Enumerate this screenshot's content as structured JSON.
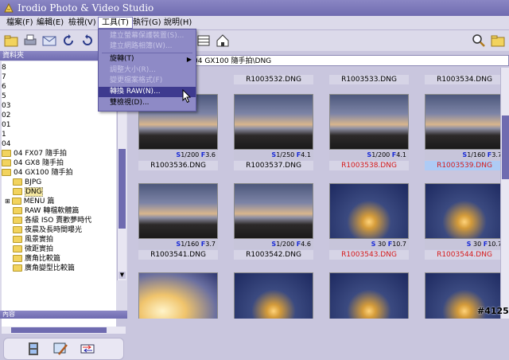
{
  "window": {
    "title": "Irodio Photo & Video Studio"
  },
  "menu": [
    {
      "label": "檔案(F)"
    },
    {
      "label": "編輯(E)"
    },
    {
      "label": "檢視(V)"
    },
    {
      "label": "工具(T)"
    },
    {
      "label": "執行(G)"
    },
    {
      "label": "說明(H)"
    }
  ],
  "tools_menu": [
    {
      "label": "建立螢幕保護裝置(S)...",
      "disabled": true
    },
    {
      "label": "建立網路相簿(W)...",
      "disabled": true
    },
    {
      "label": "旋轉(T)",
      "submenu": true
    },
    {
      "label": "調整大小(R)...",
      "disabled": true
    },
    {
      "label": "變更檔案格式(F)",
      "disabled": true
    },
    {
      "label": "轉換 RAW(N)...",
      "highlighted": true
    },
    {
      "label": "雙檢視(D)..."
    }
  ],
  "sidebar": {
    "header": "資料夾",
    "tree": [
      {
        "label": "8"
      },
      {
        "label": "7"
      },
      {
        "label": "6"
      },
      {
        "label": "5"
      },
      {
        "label": "03"
      },
      {
        "label": "02"
      },
      {
        "label": "01"
      },
      {
        "label": "1"
      },
      {
        "label": "04"
      },
      {
        "label": "04 FX07 隨手拍"
      },
      {
        "label": "04 GX8 隨手拍"
      },
      {
        "label": "04 GX100 隨手拍"
      },
      {
        "label": "BJPG"
      },
      {
        "label": "DNG"
      },
      {
        "label": "MENU 篇"
      },
      {
        "label": "RAW 轉檔軟體篇"
      },
      {
        "label": "各級 ISO 賣歡夢時代"
      },
      {
        "label": "夜晨及長時間曝光"
      },
      {
        "label": "風景實拍"
      },
      {
        "label": "微距實拍"
      },
      {
        "label": "廣角比較篇"
      },
      {
        "label": "廣角變型比較篇"
      }
    ],
    "bottom_header": "內容"
  },
  "path": "04 GX100 隨手拍\\DNG",
  "thumbnails": [
    {
      "name": "R1003532.DNG",
      "row": 0
    },
    {
      "name": "R1003533.DNG",
      "row": 0
    },
    {
      "name": "R1003534.DNG",
      "row": 0
    },
    {
      "name": "R1003536.DNG",
      "s": "1/200",
      "f": "3.6"
    },
    {
      "name": "R1003537.DNG",
      "s": "1/250",
      "f": "4.1"
    },
    {
      "name": "R1003538.DNG",
      "s": "1/200",
      "f": "4.1",
      "red": true
    },
    {
      "name": "R1003539.DNG",
      "s": "1/160",
      "f": "3.7",
      "red": true,
      "selected": true
    },
    {
      "name": "R1003541.DNG",
      "s": "1/160",
      "f": "3.7"
    },
    {
      "name": "R1003542.DNG",
      "s": "1/200",
      "f": "4.6"
    },
    {
      "name": "R1003543.DNG",
      "s": "30",
      "f": "10.7",
      "red": true
    },
    {
      "name": "R1003544.DNG",
      "s": "30",
      "f": "10.7",
      "red": true
    }
  ],
  "labels": {
    "s": "S",
    "f": "F"
  },
  "watermark": "#4125",
  "colors": {
    "title_bar": "#6f6bb0",
    "menu_highlight": "#3e3a8f",
    "red_filename": "#d61c1c"
  }
}
